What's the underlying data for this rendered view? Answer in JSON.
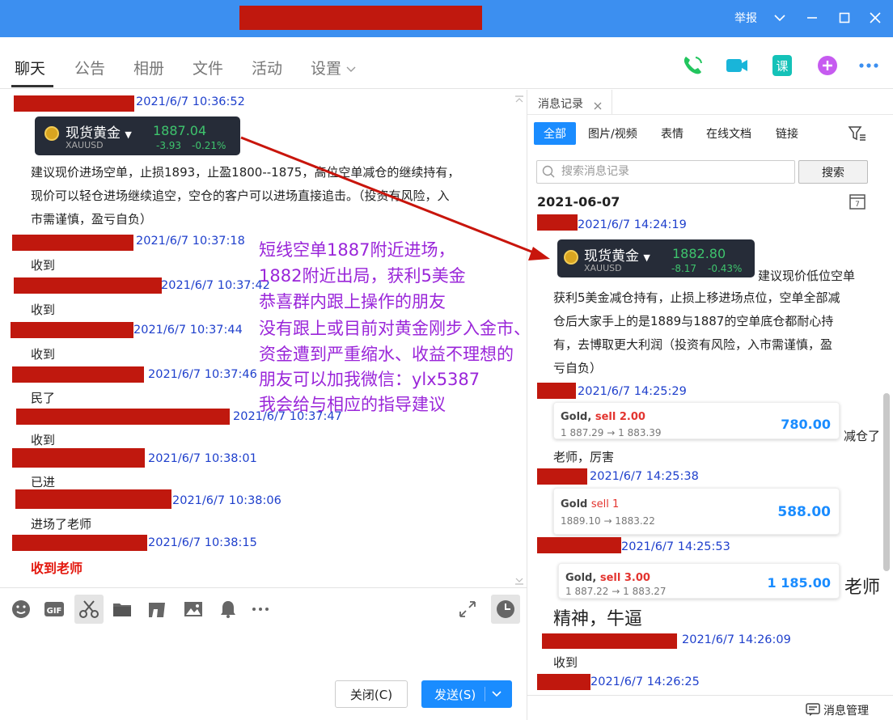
{
  "window": {
    "report_label": "举报"
  },
  "tabs": [
    {
      "label": "聊天"
    },
    {
      "label": "公告"
    },
    {
      "label": "相册"
    },
    {
      "label": "文件"
    },
    {
      "label": "活动"
    },
    {
      "label": "设置"
    }
  ],
  "header_icons": [
    "phone-icon",
    "video-icon",
    "course-icon",
    "add-icon",
    "more-icon"
  ],
  "chat": {
    "messages": [
      {
        "time": "2021/6/7 10:36:52"
      },
      {
        "card": {
          "title": "现货黄金",
          "symbol": "XAUUSD",
          "price": "1887.04",
          "change": "-3.93",
          "pct": "-0.21%"
        }
      },
      {
        "lines": [
          "建议现价进场空单，止损1893，止盈1800--1875，高位空单减仓的继续持有，",
          "现价可以轻仓进场继续追空，空仓的客户可以进场直接追击。（投资有风险，入",
          "市需谨慎，盈亏自负）"
        ]
      },
      {
        "time": "2021/6/7 10:37:18",
        "text": "收到"
      },
      {
        "time": "2021/6/7 10:37:42",
        "text": "收到"
      },
      {
        "time": "2021/6/7 10:37:44",
        "text": "收到"
      },
      {
        "time": "2021/6/7 10:37:46",
        "text": "民了"
      },
      {
        "time": "2021/6/7 10:37:47",
        "text": "收到"
      },
      {
        "time": "2021/6/7 10:38:01",
        "text": "已进"
      },
      {
        "time": "2021/6/7 10:38:06",
        "text": "进场了老师"
      },
      {
        "time": "2021/6/7 10:38:15",
        "text": "收到老师"
      }
    ],
    "overlay_lines": [
      "短线空单1887附近进场，",
      "1882附近出局，获利5美金",
      "恭喜群内跟上操作的朋友",
      "没有跟上或目前对黄金刚步入金市、",
      "资金遭到严重缩水、收益不理想的",
      "朋友可以加我微信：ylx5387",
      "我会给与相应的指导建议"
    ]
  },
  "toolbar": {
    "icons": [
      "emoji-icon",
      "gif-icon",
      "scissors-icon",
      "folder-icon",
      "music-icon",
      "image-icon",
      "bell-icon",
      "more-icon"
    ],
    "close_label": "关闭(C)",
    "send_label": "发送(S)"
  },
  "history": {
    "tab_label": "消息记录",
    "filters": [
      "全部",
      "图片/视频",
      "表情",
      "在线文档",
      "链接"
    ],
    "search_placeholder": "搜索消息记录",
    "search_button": "搜索",
    "date": "2021-06-07",
    "entries": [
      {
        "time": "2021/6/7 14:24:19"
      },
      {
        "card": {
          "title": "现货黄金",
          "symbol": "XAUUSD",
          "price": "1882.80",
          "change": "-8.17",
          "pct": "-0.43%"
        }
      },
      {
        "lines": [
          "建议现价低位空单",
          "获利5美金减仓持有，止损上移进场点位，空单全部减",
          "仓后大家手上的是1889与1887的空单底仓都耐心持",
          "有，去博取更大利润（投资有风险，入市需谨慎，盈",
          "亏自负）"
        ]
      },
      {
        "time": "2021/6/7 14:25:29",
        "trade": {
          "name": "Gold,",
          "side": "sell 2.00",
          "prices": "1 887.29 → 1 883.39",
          "profit": "780.00"
        },
        "tail": "减仓了"
      },
      {
        "text": "老师，厉害"
      },
      {
        "time": "2021/6/7 14:25:38",
        "trade": {
          "name": "Gold",
          "side": "sell 1",
          "prices": "1889.10 → 1883.22",
          "profit": "588.00"
        }
      },
      {
        "time": "2021/6/7 14:25:53",
        "trade": {
          "name": "Gold,",
          "side": "sell 3.00",
          "prices": "1 887.22 → 1 883.27",
          "profit": "1 185.00"
        },
        "tail": "老师",
        "big_text": "精神，牛逼"
      },
      {
        "time": "2021/6/7 14:26:09",
        "text": "收到"
      },
      {
        "time": "2021/6/7 14:26:25"
      }
    ],
    "footer_label": "消息管理"
  }
}
